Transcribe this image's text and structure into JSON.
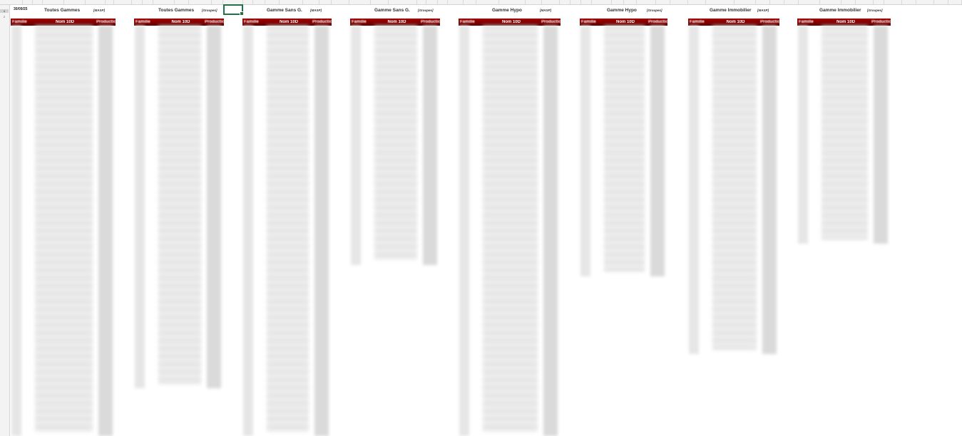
{
  "date_cell": "30/09/25",
  "row_numbers": [
    "1",
    "2"
  ],
  "selected_cell_label": "",
  "blocks": [
    {
      "title": "Toutes Gammes",
      "subtitle": "[MASP]"
    },
    {
      "title": "Toutes Gammes",
      "subtitle": "[Groupes]"
    },
    {
      "title": "Gamme Sans G.",
      "subtitle": "[MASP]"
    },
    {
      "title": "Gamme Sans G.",
      "subtitle": "[Groupes]"
    },
    {
      "title": "Gamme Hypo",
      "subtitle": "[MASP]"
    },
    {
      "title": "Gamme Hypo",
      "subtitle": "[Groupes]"
    },
    {
      "title": "Gamme Immobilier",
      "subtitle": "[MASP]"
    },
    {
      "title": "Gamme Immobilier",
      "subtitle": "[Groupes]"
    }
  ],
  "table_headers": {
    "col1": "Famille",
    "col2": "Nom 10D",
    "col3": "Production"
  },
  "colors": {
    "header_red": "#8b0000",
    "selection": "#217346"
  }
}
